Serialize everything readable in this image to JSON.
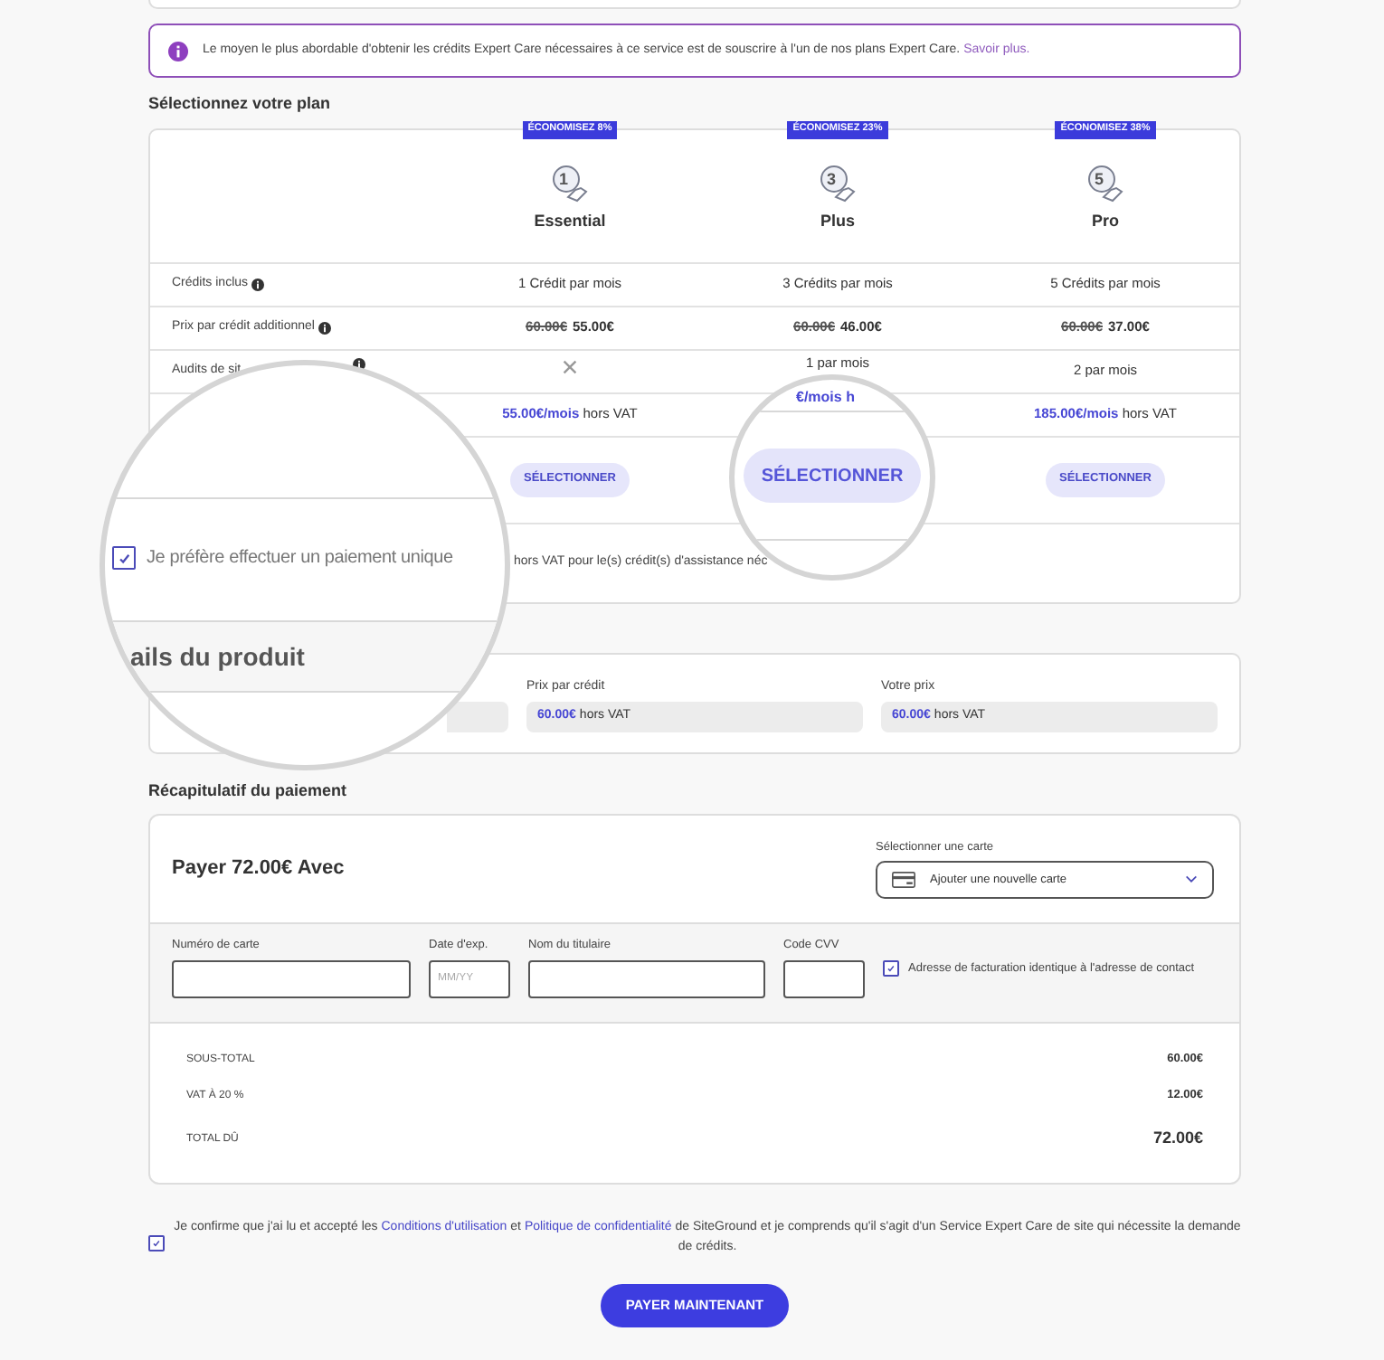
{
  "notice": {
    "text": "Le moyen le plus abordable d'obtenir les crédits Expert Care nécessaires à ce service est de souscrire à l'un de nos plans Expert Care.",
    "link": "Savoir plus."
  },
  "plan_section": {
    "title": "Sélectionnez votre plan",
    "row_labels": [
      "Crédits inclus",
      "Prix par crédit additionnel",
      "Audits de sit"
    ],
    "plans": [
      {
        "badge": "ÉCONOMISEZ 8%",
        "number": "1",
        "name": "Essential",
        "credits": "1 Crédit par mois",
        "old_price": "60.00€",
        "price": "55.00€",
        "audits": {
          "kind": "none"
        },
        "monthly": {
          "price": "55.00€/mois",
          "suffix": "hors VAT"
        },
        "button": "SÉLECTIONNER"
      },
      {
        "badge": "ÉCONOMISEZ 23%",
        "number": "3",
        "name": "Plus",
        "credits": "3 Crédits par mois",
        "old_price": "60.00€",
        "price": "46.00€",
        "audits": {
          "kind": "text",
          "text": "1 par mois"
        }
      },
      {
        "badge": "ÉCONOMISEZ 38%",
        "number": "5",
        "name": "Pro",
        "credits": "5 Crédits par mois",
        "old_price": "60.00€",
        "price": "37.00€",
        "audits": {
          "kind": "text",
          "text": "2 par mois"
        },
        "monthly": {
          "price": "185.00€/mois",
          "suffix": "hors VAT"
        },
        "button": "SÉLECTIONNER"
      }
    ],
    "one_time_fragment": "hors VAT pour le(s) crédit(s) d'assistance néc"
  },
  "magnifiers": [
    {
      "checkbox_checked": true,
      "checkbox_label": "Je préfère effectuer un paiement unique",
      "heading": "ails du produit"
    },
    {
      "price_fragment": "€/mois h",
      "button": "SÉLECTIONNER"
    }
  ],
  "product_details": {
    "fields": [
      {
        "label": "Prix par crédit",
        "value": "60.00€",
        "suffix": "hors VAT"
      },
      {
        "label": "Votre prix",
        "value": "60.00€",
        "suffix": "hors VAT"
      }
    ]
  },
  "payment": {
    "title": "Récapitulatif du paiement",
    "heading": "Payer 72.00€ Avec",
    "card_select": {
      "label": "Sélectionner une carte",
      "value": "Ajouter une nouvelle carte"
    },
    "fields": [
      {
        "label": "Numéro de carte"
      },
      {
        "label": "Date d'exp.",
        "placeholder": "MM/YY"
      },
      {
        "label": "Nom du titulaire"
      },
      {
        "label": "Code CVV"
      }
    ],
    "billing_same": {
      "checked": true,
      "label": "Adresse de facturation identique à l'adresse de contact"
    },
    "totals": [
      {
        "label": "SOUS-TOTAL",
        "value": "60.00€",
        "kind": "normal"
      },
      {
        "label": "VAT À 20 %",
        "value": "12.00€",
        "kind": "normal"
      },
      {
        "label": "TOTAL DÛ",
        "value": "72.00€",
        "kind": "grand"
      }
    ]
  },
  "confirm": {
    "checked": true,
    "parts": [
      {
        "kind": "text",
        "text": "Je confirme que j'ai lu et accepté les"
      },
      {
        "kind": "link",
        "text": "Conditions d'utilisation"
      },
      {
        "kind": "text",
        "text": "et"
      },
      {
        "kind": "link",
        "text": "Politique de confidentialité"
      },
      {
        "kind": "text",
        "text": "de SiteGround et je comprends qu'il s'agit d'un Service Expert Care de site qui nécessite la demande de crédits."
      }
    ]
  },
  "pay_button": "PAYER MAINTENANT"
}
